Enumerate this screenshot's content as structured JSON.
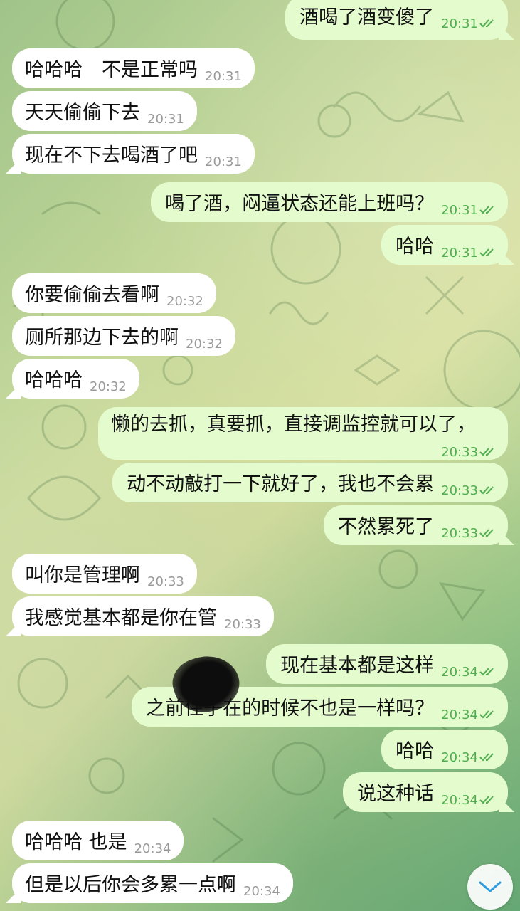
{
  "messages": [
    {
      "side": "out",
      "text": "酒喝了酒变傻了",
      "time": "20:31"
    },
    {
      "side": "in",
      "text": "哈哈哈　不是正常吗",
      "time": "20:31"
    },
    {
      "side": "in",
      "text": "天天偷偷下去",
      "time": "20:31"
    },
    {
      "side": "in",
      "text": "现在不下去喝酒了吧",
      "time": "20:31"
    },
    {
      "side": "out",
      "text": "喝了酒，闷逼状态还能上班吗？",
      "time": "20:31"
    },
    {
      "side": "out",
      "text": "哈哈",
      "time": "20:31"
    },
    {
      "side": "in",
      "text": "你要偷偷去看啊",
      "time": "20:32"
    },
    {
      "side": "in",
      "text": "厕所那边下去的啊",
      "time": "20:32"
    },
    {
      "side": "in",
      "text": "哈哈哈",
      "time": "20:32"
    },
    {
      "side": "out",
      "text": "懒的去抓，真要抓，直接调监控就可以了，",
      "time": "20:33"
    },
    {
      "side": "out",
      "text": "动不动敲打一下就好了，我也不会累",
      "time": "20:33"
    },
    {
      "side": "out",
      "text": "不然累死了",
      "time": "20:33"
    },
    {
      "side": "in",
      "text": "叫你是管理啊",
      "time": "20:33"
    },
    {
      "side": "in",
      "text": "我感觉基本都是你在管",
      "time": "20:33"
    },
    {
      "side": "out",
      "text": "现在基本都是这样",
      "time": "20:34"
    },
    {
      "side": "out",
      "text": "之前住子在的时候不也是一样吗？",
      "time": "20:34"
    },
    {
      "side": "out",
      "text": "哈哈",
      "time": "20:34"
    },
    {
      "side": "out",
      "text": "说这种话",
      "time": "20:34"
    },
    {
      "side": "in",
      "text": "哈哈哈  也是",
      "time": "20:34"
    },
    {
      "side": "in",
      "text": "但是以后你会多累一点啊",
      "time": "20:34"
    }
  ],
  "icons": {
    "read_status": "double-check-icon",
    "scroll_down": "chevron-down-icon"
  },
  "colors": {
    "incoming_bubble": "#ffffff",
    "outgoing_bubble": "#e4fbcd",
    "outgoing_time": "#4fae4e",
    "incoming_time": "#9a9a9a"
  }
}
